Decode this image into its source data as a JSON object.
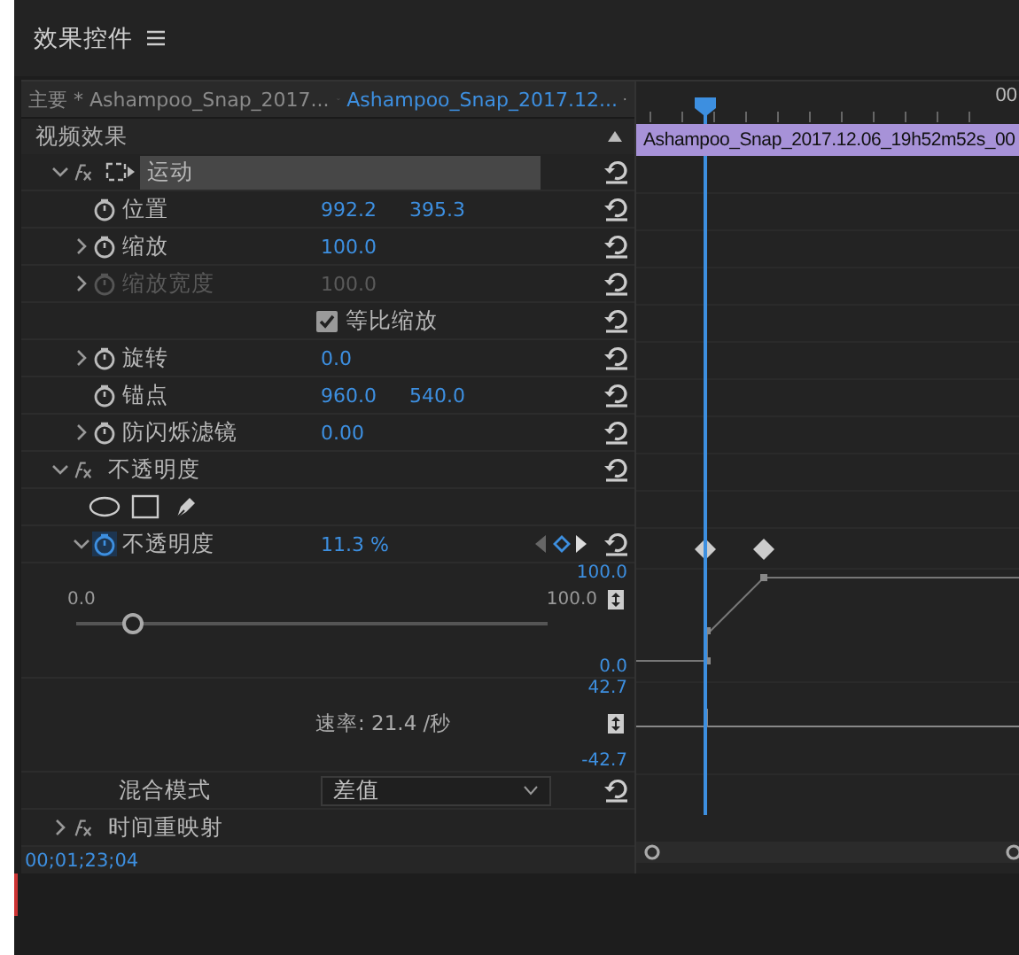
{
  "panel": {
    "title": "效果控件"
  },
  "tabs": [
    {
      "label": "主要 * Ashampoo_Snap_2017...",
      "selected": false
    },
    {
      "label": "Ashampoo_Snap_2017.12...",
      "selected": true
    }
  ],
  "section_label": "视频效果",
  "effects": [
    {
      "name": "运动",
      "expanded": true,
      "selected": true,
      "properties": [
        {
          "kind": "property",
          "name": "位置",
          "animated": false,
          "disabled": false,
          "values": [
            "992.2",
            "395.3"
          ]
        },
        {
          "kind": "property",
          "name": "缩放",
          "expanded": false,
          "animated": false,
          "disabled": false,
          "values": [
            "100.0"
          ]
        },
        {
          "kind": "property",
          "name": "缩放宽度",
          "expanded": false,
          "animated": false,
          "disabled": true,
          "values": [
            "100.0"
          ]
        },
        {
          "kind": "checkbox",
          "name": "等比缩放",
          "checked": true
        },
        {
          "kind": "property",
          "name": "旋转",
          "expanded": false,
          "animated": false,
          "disabled": false,
          "values": [
            "0.0"
          ]
        },
        {
          "kind": "property",
          "name": "锚点",
          "animated": false,
          "disabled": false,
          "values": [
            "960.0",
            "540.0"
          ]
        },
        {
          "kind": "property",
          "name": "防闪烁滤镜",
          "expanded": false,
          "animated": false,
          "disabled": false,
          "values": [
            "0.00"
          ]
        }
      ]
    },
    {
      "name": "不透明度",
      "expanded": true,
      "selected": false,
      "properties": [
        {
          "kind": "masks"
        },
        {
          "kind": "property",
          "name": "不透明度",
          "expanded": true,
          "animated": true,
          "disabled": false,
          "values": [
            "11.3 %"
          ],
          "graph": {
            "value_max": "100.0",
            "value_min": "0.0",
            "slider_min": "0.0",
            "slider_max": "100.0",
            "level": 0.12,
            "velocity_max": "42.7",
            "velocity_min": "-42.7",
            "velocity": "速率: 21.4 /秒"
          }
        },
        {
          "kind": "dropdown",
          "name": "混合模式",
          "value": "差值"
        }
      ]
    },
    {
      "name": "时间重映射",
      "expanded": false,
      "selected": false
    }
  ],
  "timecode": "00;01;23;04",
  "timeline": {
    "ruler_label": "00",
    "clip": "Ashampoo_Snap_2017.12.06_19h52m52s_00"
  }
}
